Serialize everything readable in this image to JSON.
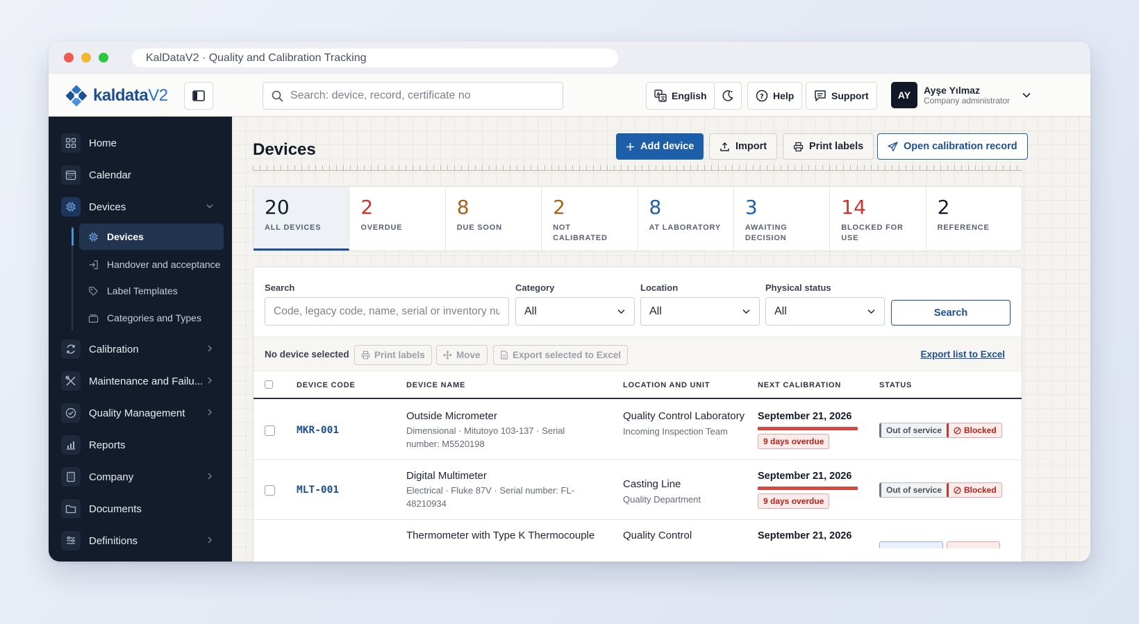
{
  "window": {
    "title": "KalDataV2 · Quality and Calibration Tracking"
  },
  "brand": {
    "name": "kaldata",
    "suffix": "V2"
  },
  "topbar": {
    "search_placeholder": "Search: device, record, certificate no",
    "language": "English",
    "help": "Help",
    "support": "Support",
    "user": {
      "initials": "AY",
      "name": "Ayşe Yılmaz",
      "role": "Company administrator"
    }
  },
  "sidebar": {
    "items": [
      {
        "label": "Home",
        "icon": "grid-icon"
      },
      {
        "label": "Calendar",
        "icon": "calendar-icon"
      },
      {
        "label": "Devices",
        "icon": "chip-icon"
      },
      {
        "label": "Calibration",
        "icon": "refresh-icon"
      },
      {
        "label": "Maintenance and Failu...",
        "icon": "tools-icon"
      },
      {
        "label": "Quality Management",
        "icon": "check-badge-icon"
      },
      {
        "label": "Reports",
        "icon": "bar-chart-icon"
      },
      {
        "label": "Company",
        "icon": "building-icon"
      },
      {
        "label": "Documents",
        "icon": "folder-icon"
      },
      {
        "label": "Definitions",
        "icon": "sliders-icon"
      }
    ],
    "sub": [
      {
        "label": "Devices"
      },
      {
        "label": "Handover and acceptance"
      },
      {
        "label": "Label Templates"
      },
      {
        "label": "Categories and Types"
      }
    ]
  },
  "page": {
    "title": "Devices",
    "actions": {
      "add": "Add device",
      "import": "Import",
      "print": "Print labels",
      "open": "Open calibration record"
    }
  },
  "stats": [
    {
      "value": "20",
      "label": "ALL DEVICES",
      "color": "#141b28"
    },
    {
      "value": "2",
      "label": "OVERDUE",
      "color": "#c8342b"
    },
    {
      "value": "8",
      "label": "DUE SOON",
      "color": "#a4621a"
    },
    {
      "value": "2",
      "label": "NOT CALIBRATED",
      "color": "#a4621a"
    },
    {
      "value": "8",
      "label": "AT LABORATORY",
      "color": "#1c5fa8"
    },
    {
      "value": "3",
      "label": "AWAITING DECISION",
      "color": "#1c5fa8"
    },
    {
      "value": "14",
      "label": "BLOCKED FOR USE",
      "color": "#c8342b"
    },
    {
      "value": "2",
      "label": "REFERENCE",
      "color": "#141b28"
    }
  ],
  "filters": {
    "search_label": "Search",
    "search_placeholder": "Code, legacy code, name, serial or inventory nu",
    "category_label": "Category",
    "category_value": "All",
    "location_label": "Location",
    "location_value": "All",
    "physical_label": "Physical status",
    "physical_value": "All",
    "search_button": "Search"
  },
  "bulk": {
    "selected": "No device selected",
    "print": "Print labels",
    "move": "Move",
    "export_selected": "Export selected to Excel",
    "export_list": "Export list to Excel"
  },
  "table": {
    "headers": [
      "DEVICE CODE",
      "DEVICE NAME",
      "LOCATION AND UNIT",
      "NEXT CALIBRATION",
      "STATUS"
    ],
    "rows": [
      {
        "code": "MKR-001",
        "name": "Outside Micrometer",
        "sub": "Dimensional · Mitutoyo 103-137 · Serial number: M5520198",
        "location": "Quality Control Laboratory",
        "unit": "Incoming Inspection Team",
        "date": "September 21, 2026",
        "overdue": "9 days overdue",
        "status1": "Out of service",
        "status2": "Blocked"
      },
      {
        "code": "MLT-001",
        "name": "Digital Multimeter",
        "sub": "Electrical · Fluke 87V · Serial number: FL-48210934",
        "location": "Casting Line",
        "unit": "Quality Department",
        "date": "September 21, 2026",
        "overdue": "9 days overdue",
        "status1": "Out of service",
        "status2": "Blocked"
      },
      {
        "code": "",
        "name": "Thermometer with Type K Thermocouple",
        "sub": "",
        "location": "Quality Control",
        "unit": "",
        "date": "September 21, 2026"
      }
    ]
  },
  "colors": {
    "primary": "#1c4f93",
    "sidebar": "#131c2b",
    "danger": "#c8342b"
  }
}
